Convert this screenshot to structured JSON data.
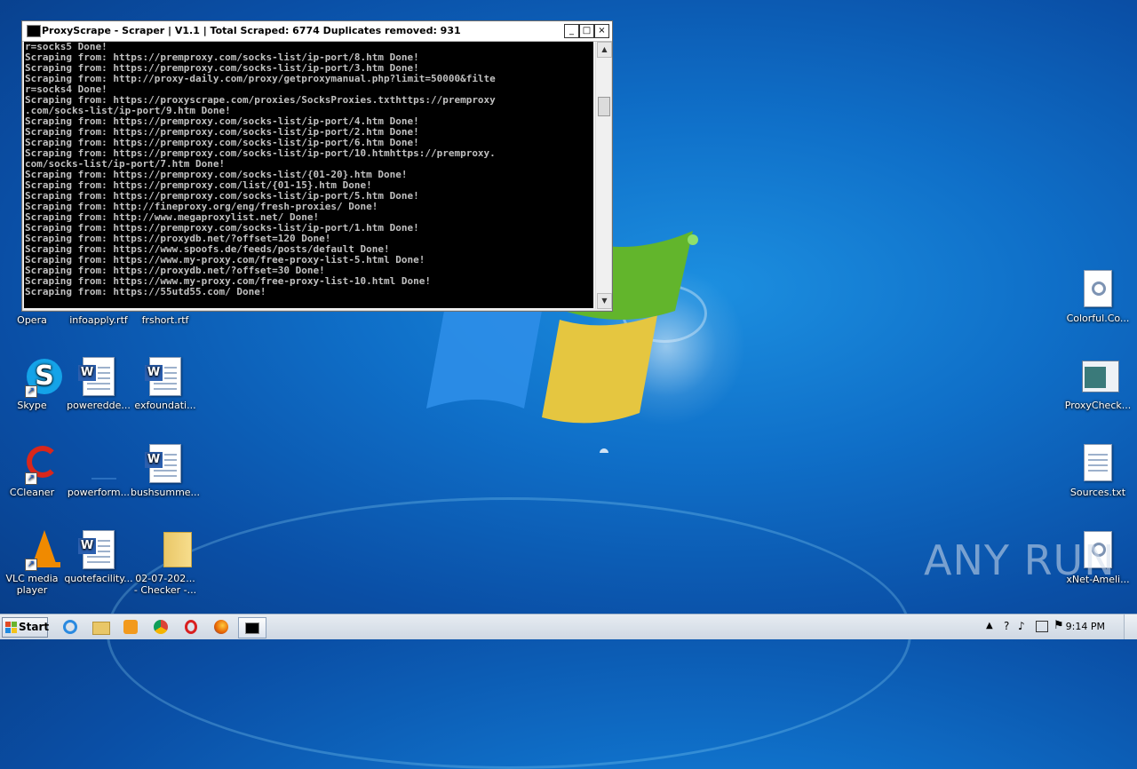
{
  "window": {
    "title": "ProxyScrape - Scraper | V1.1 | Total Scraped: 6774 Duplicates removed: 931",
    "minimize": "_",
    "maximize": "□",
    "close": "×"
  },
  "console_lines": [
    "r=socks5 Done!",
    "Scraping from: https://premproxy.com/socks-list/ip-port/8.htm Done!",
    "Scraping from: https://premproxy.com/socks-list/ip-port/3.htm Done!",
    "Scraping from: http://proxy-daily.com/proxy/getproxymanual.php?limit=50000&filte",
    "r=socks4 Done!",
    "Scraping from: https://proxyscrape.com/proxies/SocksProxies.txthttps://premproxy",
    ".com/socks-list/ip-port/9.htm Done!",
    "Scraping from: https://premproxy.com/socks-list/ip-port/4.htm Done!",
    "Scraping from: https://premproxy.com/socks-list/ip-port/2.htm Done!",
    "Scraping from: https://premproxy.com/socks-list/ip-port/6.htm Done!",
    "Scraping from: https://premproxy.com/socks-list/ip-port/10.htmhttps://premproxy.",
    "com/socks-list/ip-port/7.htm Done!",
    "Scraping from: https://premproxy.com/socks-list/{01-20}.htm Done!",
    "Scraping from: https://premproxy.com/list/{01-15}.htm Done!",
    "Scraping from: https://premproxy.com/socks-list/ip-port/5.htm Done!",
    "Scraping from: http://fineproxy.org/eng/fresh-proxies/ Done!",
    "Scraping from: http://www.megaproxylist.net/ Done!",
    "Scraping from: https://premproxy.com/socks-list/ip-port/1.htm Done!",
    "Scraping from: https://proxydb.net/?offset=120 Done!",
    "Scraping from: https://www.spoofs.de/feeds/posts/default Done!",
    "Scraping from: https://www.my-proxy.com/free-proxy-list-5.html Done!",
    "Scraping from: https://proxydb.net/?offset=30 Done!",
    "Scraping from: https://www.my-proxy.com/free-proxy-list-10.html Done!",
    "Scraping from: https://55utd55.com/ Done!"
  ],
  "desktop_icons": {
    "opera": "Opera",
    "infoapply": "infoapply.rtf",
    "frshort": "frshort.rtf",
    "skype": "Skype",
    "poweredde": "poweredde...",
    "exfoundati": "exfoundati...",
    "ccleaner": "CCleaner",
    "powerform": "powerform...",
    "bushsumme": "bushsumme...",
    "vlc_line1": "VLC media",
    "vlc_line2": "player",
    "quotefacility": "quotefacility...",
    "checker_line1": "02-07-202...",
    "checker_line2": "- Checker -...",
    "colorful": "Colorful.Co...",
    "proxycheck": "ProxyCheck...",
    "sources": "Sources.txt",
    "xnet": "xNet-Ameli..."
  },
  "taskbar": {
    "start": "Start",
    "clock": "9:14 PM"
  },
  "watermark": "ANY RUN"
}
